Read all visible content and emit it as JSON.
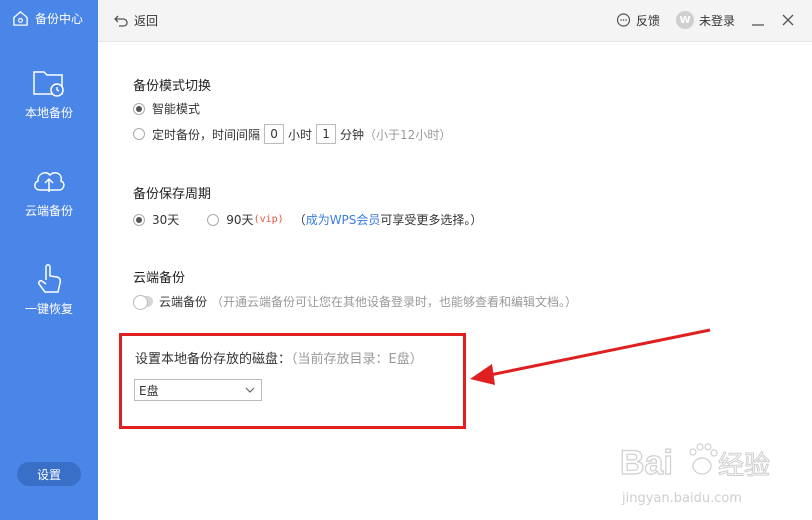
{
  "sidebar": {
    "brand": "备份中心",
    "items": [
      {
        "label": "本地备份",
        "icon": "folder-clock-icon"
      },
      {
        "label": "云端备份",
        "icon": "cloud-upload-icon"
      },
      {
        "label": "一键恢复",
        "icon": "hand-tap-icon"
      }
    ],
    "settings_label": "设置",
    "color": "#4a86e8"
  },
  "topbar": {
    "back_label": "返回",
    "feedback_label": "反馈",
    "login_label": "未登录",
    "avatar_letter": "W"
  },
  "mode": {
    "title": "备份模式切换",
    "smart_label": "智能模式",
    "timed_label": "定时备份，时间间隔",
    "hours_value": "0",
    "hours_unit": "小时",
    "minutes_value": "1",
    "minutes_unit": "分钟",
    "timed_hint": "（小于12小时）"
  },
  "period": {
    "title": "备份保存周期",
    "opt30": "30天",
    "opt90": "90天",
    "vip_tag": "(vip)",
    "note_open": "（",
    "member_link": "成为WPS会员",
    "note_rest": " 可享受更多选择。）"
  },
  "cloud": {
    "title": "云端备份",
    "toggle_label": "云端备份",
    "hint": "（开通云端备份可让您在其他设备登录时，也能够查看和编辑文档。）"
  },
  "disk": {
    "label": "设置本地备份存放的磁盘：",
    "current_hint": "（当前存放目录：E盘）",
    "selected": "E盘"
  },
  "watermark": {
    "brand": "Bai",
    "brand2": "经验",
    "url": "jingyan.baidu.com"
  },
  "colors": {
    "accent": "#4a86e8",
    "highlight": "#e02020",
    "link": "#3b7ddd"
  }
}
